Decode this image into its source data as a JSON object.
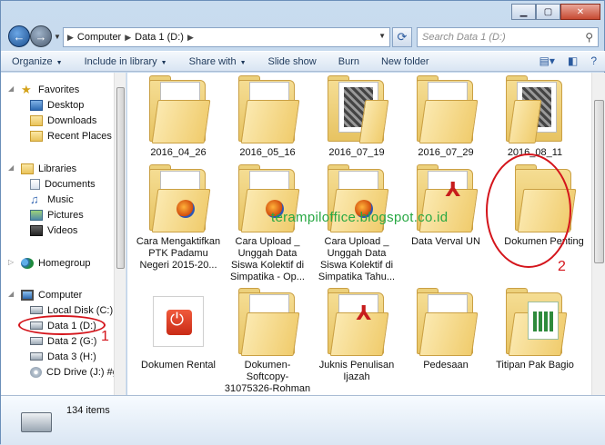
{
  "address": {
    "segments": [
      "Computer",
      "Data 1 (D:)"
    ]
  },
  "search": {
    "placeholder": "Search Data 1 (D:)"
  },
  "toolbar": {
    "organize": "Organize",
    "include": "Include in library",
    "share": "Share with",
    "slideshow": "Slide show",
    "burn": "Burn",
    "newfolder": "New folder"
  },
  "nav": {
    "favorites": "Favorites",
    "desktop": "Desktop",
    "downloads": "Downloads",
    "recent": "Recent Places",
    "libraries": "Libraries",
    "documents": "Documents",
    "music": "Music",
    "pictures": "Pictures",
    "videos": "Videos",
    "homegroup": "Homegroup",
    "computer": "Computer",
    "localdisk": "Local Disk (C:)",
    "data1": "Data 1 (D:)",
    "data2": "Data 2 (G:)",
    "data3": "Data 3 (H:)",
    "cddrive": "CD Drive (J:) #goo"
  },
  "files": [
    {
      "label": "2016_04_26"
    },
    {
      "label": "2016_05_16"
    },
    {
      "label": "2016_07_19"
    },
    {
      "label": "2016_07_29"
    },
    {
      "label": "2016_08_11"
    },
    {
      "label": "Cara Mengaktifkan PTK Padamu Negeri 2015-20..."
    },
    {
      "label": "Cara Upload _ Unggah Data Siswa Kolektif di Simpatika - Op..."
    },
    {
      "label": "Cara Upload _ Unggah Data Siswa Kolektif di Simpatika Tahu..."
    },
    {
      "label": "Data Verval UN"
    },
    {
      "label": "Dokumen Penting"
    },
    {
      "label": "Dokumen Rental"
    },
    {
      "label": "Dokumen-Softcopy-31075326-Rohman"
    },
    {
      "label": "Juknis Penulisan Ijazah"
    },
    {
      "label": "Pedesaan"
    },
    {
      "label": "Titipan Pak Bagio"
    }
  ],
  "watermark": "terampiloffice.blogspot.co.id",
  "annotations": {
    "one": "1",
    "two": "2"
  },
  "status": {
    "count": "134 items"
  },
  "colors": {
    "annotation": "#d4141b",
    "watermark": "#28a843"
  }
}
